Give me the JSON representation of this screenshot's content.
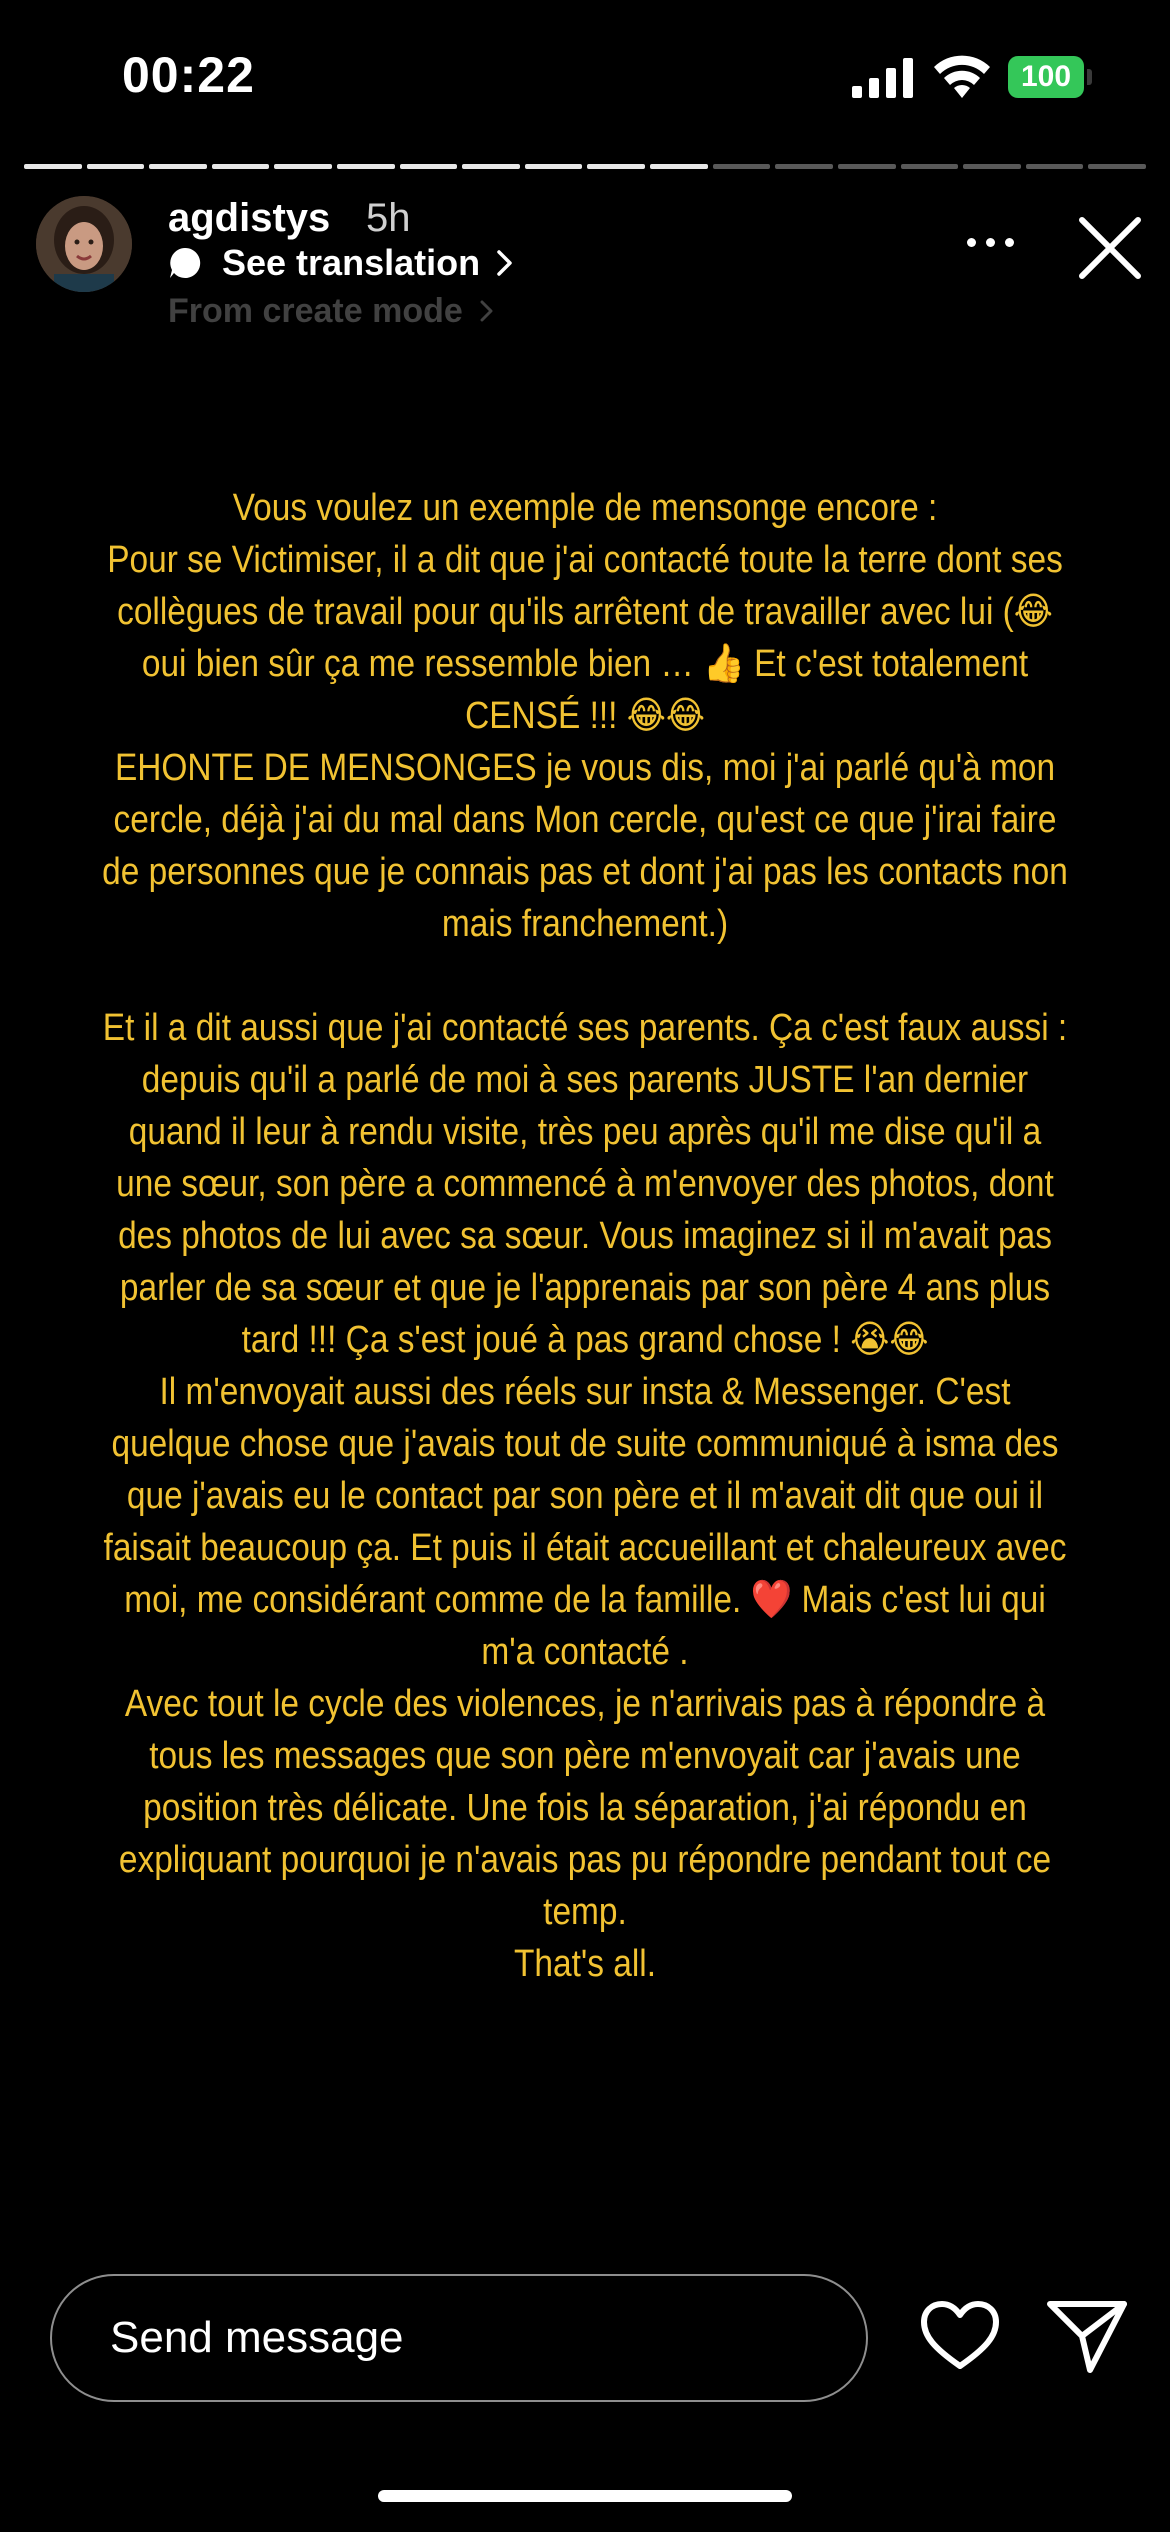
{
  "status_bar": {
    "time": "00:22",
    "battery": "100",
    "battery_color": "#34c759"
  },
  "story": {
    "progress": {
      "segments": 18,
      "completed": 11
    },
    "user": {
      "username": "agdistys",
      "time_ago": "5h",
      "translate_label": "See translation",
      "mode_label": "From create mode"
    },
    "icons": {
      "more": "ellipsis-icon",
      "close": "close-icon",
      "translate": "translate-icon"
    },
    "text_color": "#f1c232",
    "paragraphs": [
      [
        "Vous voulez un exemple de mensonge encore :",
        "Pour se Victimiser, il a dit que j'ai contacté toute la terre dont ses collègues de travail pour qu'ils arrêtent de travailler avec lui (😂 oui bien sûr ça me ressemble bien … 👍 Et c'est totalement CENSÉ !!! 😂😂",
        "EHONTE DE MENSONGES je vous dis, moi j'ai parlé qu'à mon cercle, déjà j'ai du mal dans Mon cercle, qu'est ce que j'irai faire de personnes que je connais pas et dont j'ai pas les contacts non mais franchement.)"
      ],
      [
        "Et il a dit aussi que j'ai contacté ses parents. Ça c'est faux aussi : depuis qu'il a parlé de moi à ses parents JUSTE l'an dernier quand il leur à rendu visite, très peu après qu'il me dise qu'il a une sœur, son père a commencé à m'envoyer des photos, dont des photos de lui avec sa sœur. Vous imaginez si il m'avait pas parler de sa sœur et que je l'apprenais par son père 4 ans plus tard !!! Ça s'est joué à pas grand chose ! 😭😂",
        "Il m'envoyait aussi des réels sur insta & Messenger. C'est quelque chose que j'avais tout de suite communiqué à isma des que j'avais eu le contact par son père et il m'avait dit que oui il faisait beaucoup ça. Et puis il était accueillant et chaleureux avec moi, me considérant comme de la famille. ❤️ Mais c'est lui qui m'a contacté .",
        "Avec tout le cycle des violences, je n'arrivais pas à répondre à tous les messages que son père m'envoyait car j'avais une position très délicate. Une fois la séparation, j'ai répondu en expliquant pourquoi je n'avais pas pu répondre pendant tout ce temp.",
        "That's all."
      ]
    ]
  },
  "reply_bar": {
    "placeholder": "Send message",
    "like_icon": "heart-icon",
    "share_icon": "send-icon"
  }
}
